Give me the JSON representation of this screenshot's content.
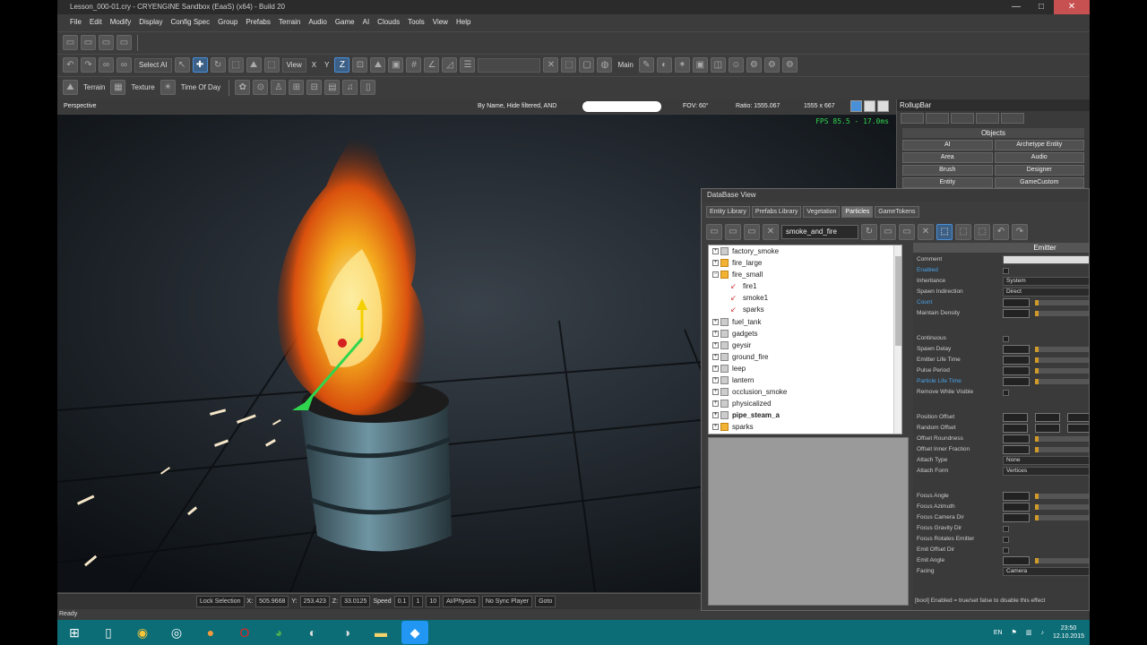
{
  "window": {
    "title": "Lesson_000-01.cry - CRYENGINE Sandbox (EaaS) (x64) - Build 20",
    "minimize": "—",
    "maximize": "□",
    "close": "✕"
  },
  "menu": [
    "File",
    "Edit",
    "Modify",
    "Display",
    "Config Spec",
    "Group",
    "Prefabs",
    "Terrain",
    "Audio",
    "Game",
    "AI",
    "Clouds",
    "Tools",
    "View",
    "Help"
  ],
  "toolbar2": {
    "select_ai": "Select AI",
    "view": "View",
    "axis_x": "X",
    "axis_y": "Y",
    "axis_z": "Z",
    "main": "Main"
  },
  "toolbar3": {
    "terrain": "Terrain",
    "texture": "Texture",
    "time_of_day": "Time Of Day"
  },
  "viewport": {
    "name": "Perspective",
    "filter": "By Name, Hide filtered, AND",
    "fov": "FOV:   60°",
    "ratio": "Ratio:   1555.067",
    "resolution": "1555 x 667",
    "fps": "FPS 85.5 - 17.0ms"
  },
  "statusbar": {
    "lock_selection": "Lock Selection",
    "x_label": "X:",
    "x_value": "505.9668",
    "y_label": "Y:",
    "y_value": "253.423",
    "z_label": "Z:",
    "z_value": "33.0125",
    "speed_label": "Speed",
    "speed_value": "0.1",
    "speed_1": "1",
    "speed_10": "10",
    "ai_physics": "AI/Physics",
    "no_sync": "No Sync Player",
    "goto": "Goto",
    "ready": "Ready"
  },
  "rollupbar": {
    "title": "RollupBar",
    "objects_header": "Objects",
    "buttons": [
      "AI",
      "Archetype Entity",
      "Area",
      "Audio",
      "Brush",
      "Designer",
      "Entity",
      "GameCustom"
    ]
  },
  "database_view": {
    "title": "DataBase View",
    "tabs": [
      {
        "label": "Entity Library",
        "active": false
      },
      {
        "label": "Prefabs Library",
        "active": false
      },
      {
        "label": "Vegetation",
        "active": false
      },
      {
        "label": "Particles",
        "active": true
      },
      {
        "label": "GameTokens",
        "active": false
      }
    ],
    "library": "smoke_and_fire",
    "tree": [
      {
        "label": "factory_smoke",
        "level": 0,
        "lib": false,
        "bold": false
      },
      {
        "label": "fire_large",
        "level": 0,
        "lib": true,
        "bold": false
      },
      {
        "label": "fire_small",
        "level": 0,
        "lib": true,
        "bold": false,
        "open": true
      },
      {
        "label": "fire1",
        "level": 1
      },
      {
        "label": "smoke1",
        "level": 1
      },
      {
        "label": "sparks",
        "level": 1
      },
      {
        "label": "fuel_tank",
        "level": 0,
        "lib": false,
        "bold": false
      },
      {
        "label": "gadgets",
        "level": 0,
        "lib": false,
        "bold": false
      },
      {
        "label": "geysir",
        "level": 0,
        "lib": false,
        "bold": false
      },
      {
        "label": "ground_fire",
        "level": 0,
        "lib": false,
        "bold": false
      },
      {
        "label": "leep",
        "level": 0,
        "lib": false,
        "bold": false
      },
      {
        "label": "lantern",
        "level": 0,
        "lib": false,
        "bold": false
      },
      {
        "label": "occlusion_smoke",
        "level": 0,
        "lib": false,
        "bold": false
      },
      {
        "label": "physicalized",
        "level": 0,
        "lib": false,
        "bold": false
      },
      {
        "label": "pipe_steam_a",
        "level": 0,
        "lib": false,
        "bold": true
      },
      {
        "label": "sparks",
        "level": 0,
        "lib": true,
        "bold": false
      }
    ],
    "props_header": "Emitter",
    "props": [
      {
        "label": "Comment",
        "kind": "white",
        "value": ""
      },
      {
        "label": "Enabled",
        "kind": "check",
        "hl": true
      },
      {
        "label": "Inheritance",
        "kind": "text",
        "value": "System"
      },
      {
        "label": "Spawn Indirection",
        "kind": "text",
        "value": "Direct"
      },
      {
        "label": "Count",
        "kind": "num",
        "hl": true
      },
      {
        "label": "Maintain Density",
        "kind": "num"
      },
      {
        "label": "",
        "kind": "gap"
      },
      {
        "label": "",
        "kind": "gap"
      },
      {
        "label": "Continuous",
        "kind": "check"
      },
      {
        "label": "Spawn Delay",
        "kind": "num"
      },
      {
        "label": "Emitter Life Time",
        "kind": "num"
      },
      {
        "label": "Pulse Period",
        "kind": "num"
      },
      {
        "label": "Particle Life Time",
        "kind": "num",
        "hl": true
      },
      {
        "label": "Remove While Visible",
        "kind": "check"
      },
      {
        "label": "",
        "kind": "gap"
      },
      {
        "label": "",
        "kind": "gap"
      },
      {
        "label": "Position Offset",
        "kind": "triple"
      },
      {
        "label": "Random Offset",
        "kind": "triple"
      },
      {
        "label": "Offset Roundness",
        "kind": "num"
      },
      {
        "label": "Offset Inner Fraction",
        "kind": "num"
      },
      {
        "label": "Attach Type",
        "kind": "text",
        "value": "None"
      },
      {
        "label": "Attach Form",
        "kind": "text",
        "value": "Vertices"
      },
      {
        "label": "",
        "kind": "gap"
      },
      {
        "label": "",
        "kind": "gap"
      },
      {
        "label": "Focus Angle",
        "kind": "num"
      },
      {
        "label": "Focus Azimuth",
        "kind": "num"
      },
      {
        "label": "Focus Camera Dir",
        "kind": "num"
      },
      {
        "label": "Focus Gravity Dir",
        "kind": "check"
      },
      {
        "label": "Focus Rotates Emitter",
        "kind": "check"
      },
      {
        "label": "Emit Offset Dir",
        "kind": "check"
      },
      {
        "label": "Emit Angle",
        "kind": "num"
      },
      {
        "label": "Facing",
        "kind": "text",
        "value": "Camera"
      }
    ],
    "footer": "[bool] Enabled = true/set false to disable this effect"
  },
  "taskbar": {
    "lang": "EN",
    "time": "23:50",
    "date": "12.10.2015"
  }
}
